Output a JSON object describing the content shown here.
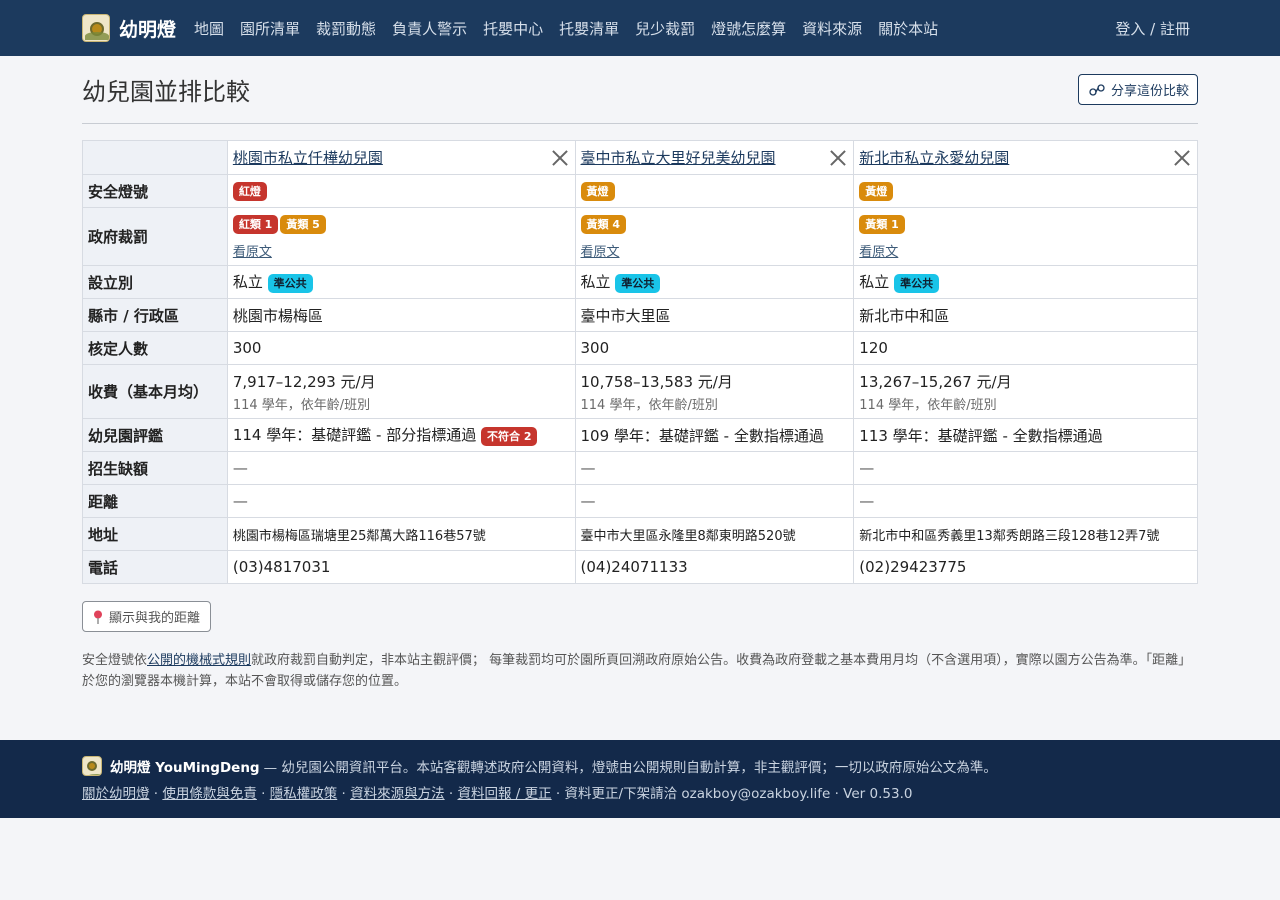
{
  "nav": {
    "brand": "幼明燈",
    "links": [
      "地圖",
      "園所清單",
      "裁罰動態",
      "負責人警示",
      "托嬰中心",
      "托嬰清單",
      "兒少裁罰",
      "燈號怎麼算",
      "資料來源",
      "關於本站"
    ],
    "login": "登入 / 註冊"
  },
  "page": {
    "title": "幼兒園並排比較",
    "share_label": "分享這份比較"
  },
  "table": {
    "row_labels": {
      "light": "安全燈號",
      "penalty": "政府裁罰",
      "type": "設立別",
      "district": "縣市 / 行政區",
      "capacity": "核定人數",
      "fee": "收費（基本月均）",
      "evaluation": "幼兒園評鑑",
      "vacancy": "招生缺額",
      "distance": "距離",
      "address": "地址",
      "phone": "電話"
    },
    "schools": [
      {
        "name": "桃園市私立仟樺幼兒園",
        "light": "紅燈",
        "light_color": "#c6352d",
        "penalties": [
          {
            "label": "紅類 1",
            "color": "#c6352d"
          },
          {
            "label": "黃類 5",
            "color": "#d98b0c"
          }
        ],
        "view_original": "看原文",
        "type": "私立",
        "type_badge": "準公共",
        "district": "桃園市楊梅區",
        "capacity": "300",
        "fee": "7,917–12,293 元/月",
        "fee_note": "114 學年，依年齡/班別",
        "evaluation": "114 學年：基礎評鑑 - 部分指標通過",
        "evaluation_badge": "不符合 2",
        "vacancy": "—",
        "distance": "—",
        "address": "桃園市楊梅區瑞塘里25鄰萬大路116巷57號",
        "phone": "(03)4817031"
      },
      {
        "name": "臺中市私立大里好兒美幼兒園",
        "light": "黃燈",
        "light_color": "#d98b0c",
        "penalties": [
          {
            "label": "黃類 4",
            "color": "#d98b0c"
          }
        ],
        "view_original": "看原文",
        "type": "私立",
        "type_badge": "準公共",
        "district": "臺中市大里區",
        "capacity": "300",
        "fee": "10,758–13,583 元/月",
        "fee_note": "114 學年，依年齡/班別",
        "evaluation": "109 學年：基礎評鑑 - 全數指標通過",
        "evaluation_badge": "",
        "vacancy": "—",
        "distance": "—",
        "address": "臺中市大里區永隆里8鄰東明路520號",
        "phone": "(04)24071133"
      },
      {
        "name": "新北市私立永愛幼兒園",
        "light": "黃燈",
        "light_color": "#d98b0c",
        "penalties": [
          {
            "label": "黃類 1",
            "color": "#d98b0c"
          }
        ],
        "view_original": "看原文",
        "type": "私立",
        "type_badge": "準公共",
        "district": "新北市中和區",
        "capacity": "120",
        "fee": "13,267–15,267 元/月",
        "fee_note": "114 學年，依年齡/班別",
        "evaluation": "113 學年：基礎評鑑 - 全數指標通過",
        "evaluation_badge": "",
        "vacancy": "—",
        "distance": "—",
        "address": "新北市中和區秀義里13鄰秀朗路三段128巷12弄7號",
        "phone": "(02)29423775"
      }
    ]
  },
  "distance_button": "顯示與我的距離",
  "note": {
    "prefix": "安全燈號依",
    "rule_link": "公開的機械式規則",
    "suffix": "就政府裁罰自動判定，非本站主觀評價； 每筆裁罰均可於園所頁回溯政府原始公告。收費為政府登載之基本費用月均（不含選用項），實際以園方公告為準。「距離」於您的瀏覽器本機計算，本站不會取得或儲存您的位置。"
  },
  "footer": {
    "brand": "幼明燈 YouMingDeng",
    "tagline": "— 幼兒園公開資訊平台。本站客觀轉述政府公開資料，燈號由公開規則自動計算，非主觀評價；一切以政府原始公文為準。",
    "links": [
      "關於幼明燈",
      "使用條款與免責",
      "隱私權政策",
      "資料來源與方法",
      "資料回報 / 更正"
    ],
    "contact": "資料更正/下架請洽 ozakboy@ozakboy.life",
    "version": "Ver 0.53.0"
  }
}
